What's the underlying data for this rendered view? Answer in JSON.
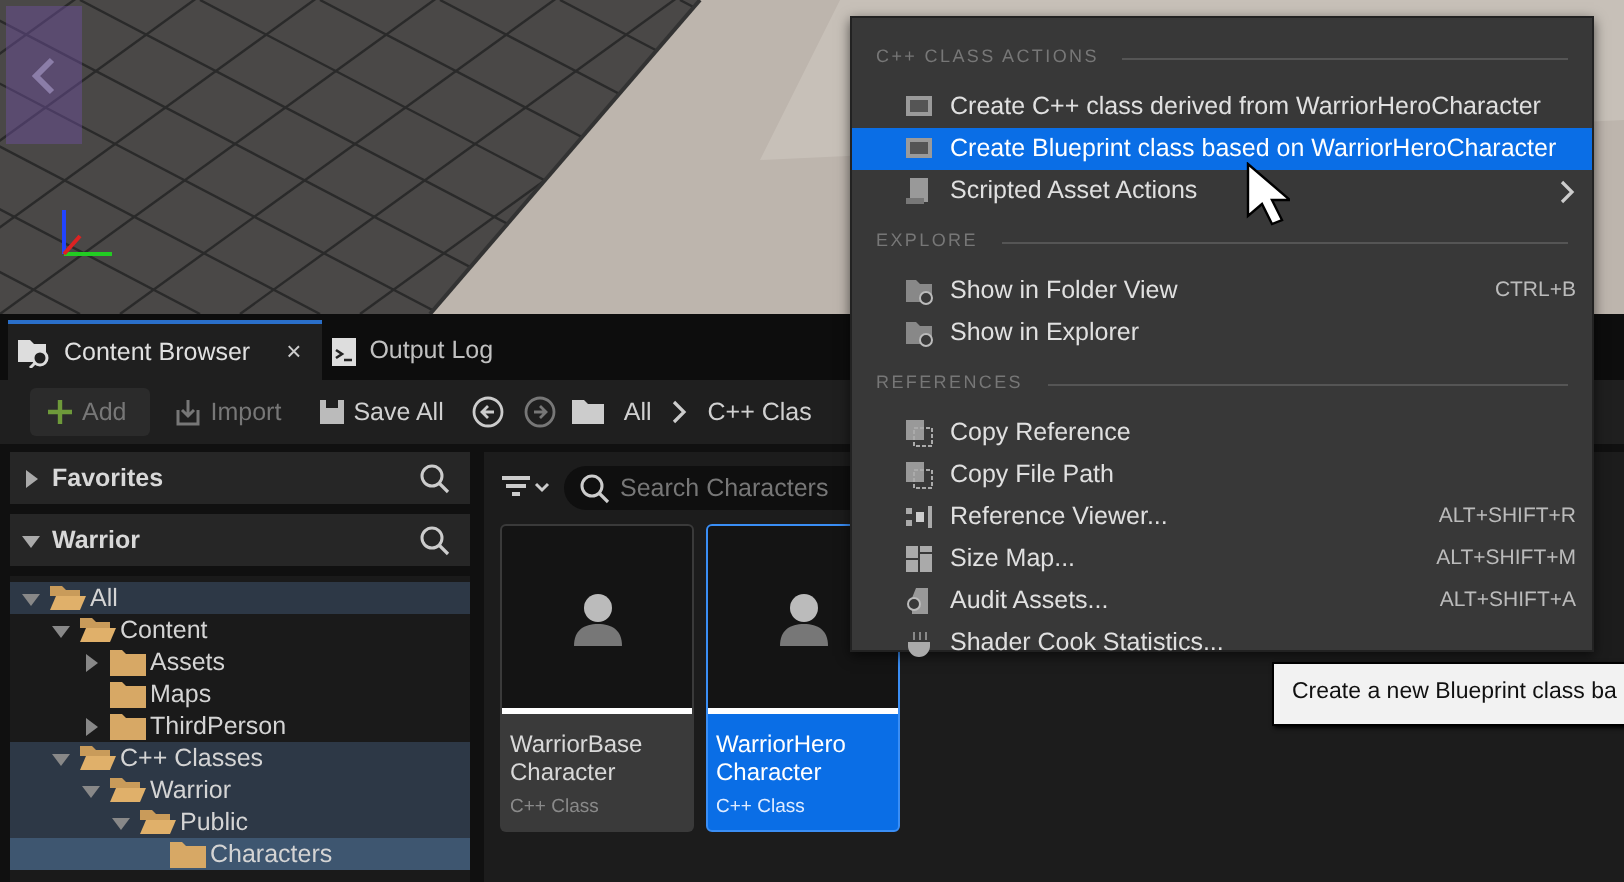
{
  "tabs": [
    {
      "label": "Content Browser",
      "selected": true,
      "close": "×"
    },
    {
      "label": "Output Log",
      "selected": false
    }
  ],
  "toolbar": {
    "buttons": [
      {
        "label": "Add",
        "kind": "add",
        "disabled": true
      },
      {
        "label": "Import",
        "kind": "import",
        "disabled": true
      },
      {
        "label": "Save All",
        "kind": "save",
        "disabled": false
      }
    ],
    "breadcrumb": [
      "All",
      "C++ Clas"
    ]
  },
  "sidebar": {
    "sections": [
      {
        "title": "Favorites",
        "expanded": false
      },
      {
        "title": "Warrior",
        "expanded": true
      }
    ],
    "tree": [
      {
        "label": "All",
        "expanded": true,
        "expandable": true,
        "selected": false,
        "on_path": true,
        "children": [
          {
            "label": "Content",
            "expanded": true,
            "expandable": true,
            "selected": false,
            "on_path": false,
            "children": [
              {
                "label": "Assets",
                "expanded": false,
                "expandable": true,
                "selected": false,
                "on_path": false
              },
              {
                "label": "Maps",
                "expanded": false,
                "expandable": false,
                "selected": false,
                "on_path": false
              },
              {
                "label": "ThirdPerson",
                "expanded": false,
                "expandable": true,
                "selected": false,
                "on_path": false
              }
            ]
          },
          {
            "label": "C++ Classes",
            "expanded": true,
            "expandable": true,
            "selected": false,
            "on_path": true,
            "children": [
              {
                "label": "Warrior",
                "expanded": true,
                "expandable": true,
                "selected": false,
                "on_path": true,
                "children": [
                  {
                    "label": "Public",
                    "expanded": true,
                    "expandable": true,
                    "selected": false,
                    "on_path": true,
                    "children": [
                      {
                        "label": "Characters",
                        "expanded": false,
                        "expandable": false,
                        "selected": true,
                        "on_path": true
                      }
                    ]
                  }
                ]
              }
            ]
          }
        ]
      }
    ]
  },
  "content": {
    "search": {
      "placeholder": "Search Characters"
    },
    "assets": [
      {
        "name": "WarriorBase Character",
        "type": "C++ Class",
        "selected": false
      },
      {
        "name": "WarriorHero Character",
        "type": "C++ Class",
        "selected": true
      }
    ]
  },
  "context_menu": {
    "sections": [
      {
        "title": "C++ CLASS ACTIONS",
        "items": [
          {
            "label": "Create C++ class derived from WarriorHeroCharacter",
            "kind": "class",
            "selected": false
          },
          {
            "label": "Create Blueprint class based on WarriorHeroCharacter",
            "kind": "class",
            "selected": true
          },
          {
            "label": "Scripted Asset Actions",
            "kind": "script",
            "selected": false,
            "submenu": true
          }
        ]
      },
      {
        "title": "EXPLORE",
        "items": [
          {
            "label": "Show in Folder View",
            "kind": "folder",
            "selected": false,
            "shortcut": "CTRL+B"
          },
          {
            "label": "Show in Explorer",
            "kind": "folder",
            "selected": false
          }
        ]
      },
      {
        "title": "REFERENCES",
        "items": [
          {
            "label": "Copy Reference",
            "kind": "copy",
            "selected": false
          },
          {
            "label": "Copy File Path",
            "kind": "copy",
            "selected": false
          },
          {
            "label": "Reference Viewer...",
            "kind": "graph",
            "selected": false,
            "shortcut": "ALT+SHIFT+R"
          },
          {
            "label": "Size Map...",
            "kind": "sizemap",
            "selected": false,
            "shortcut": "ALT+SHIFT+M"
          },
          {
            "label": "Audit Assets...",
            "kind": "audit",
            "selected": false,
            "shortcut": "ALT+SHIFT+A"
          },
          {
            "label": "Shader Cook Statistics...",
            "kind": "shader",
            "selected": false
          }
        ]
      }
    ]
  },
  "tooltip": "Create a new Blueprint class ba"
}
